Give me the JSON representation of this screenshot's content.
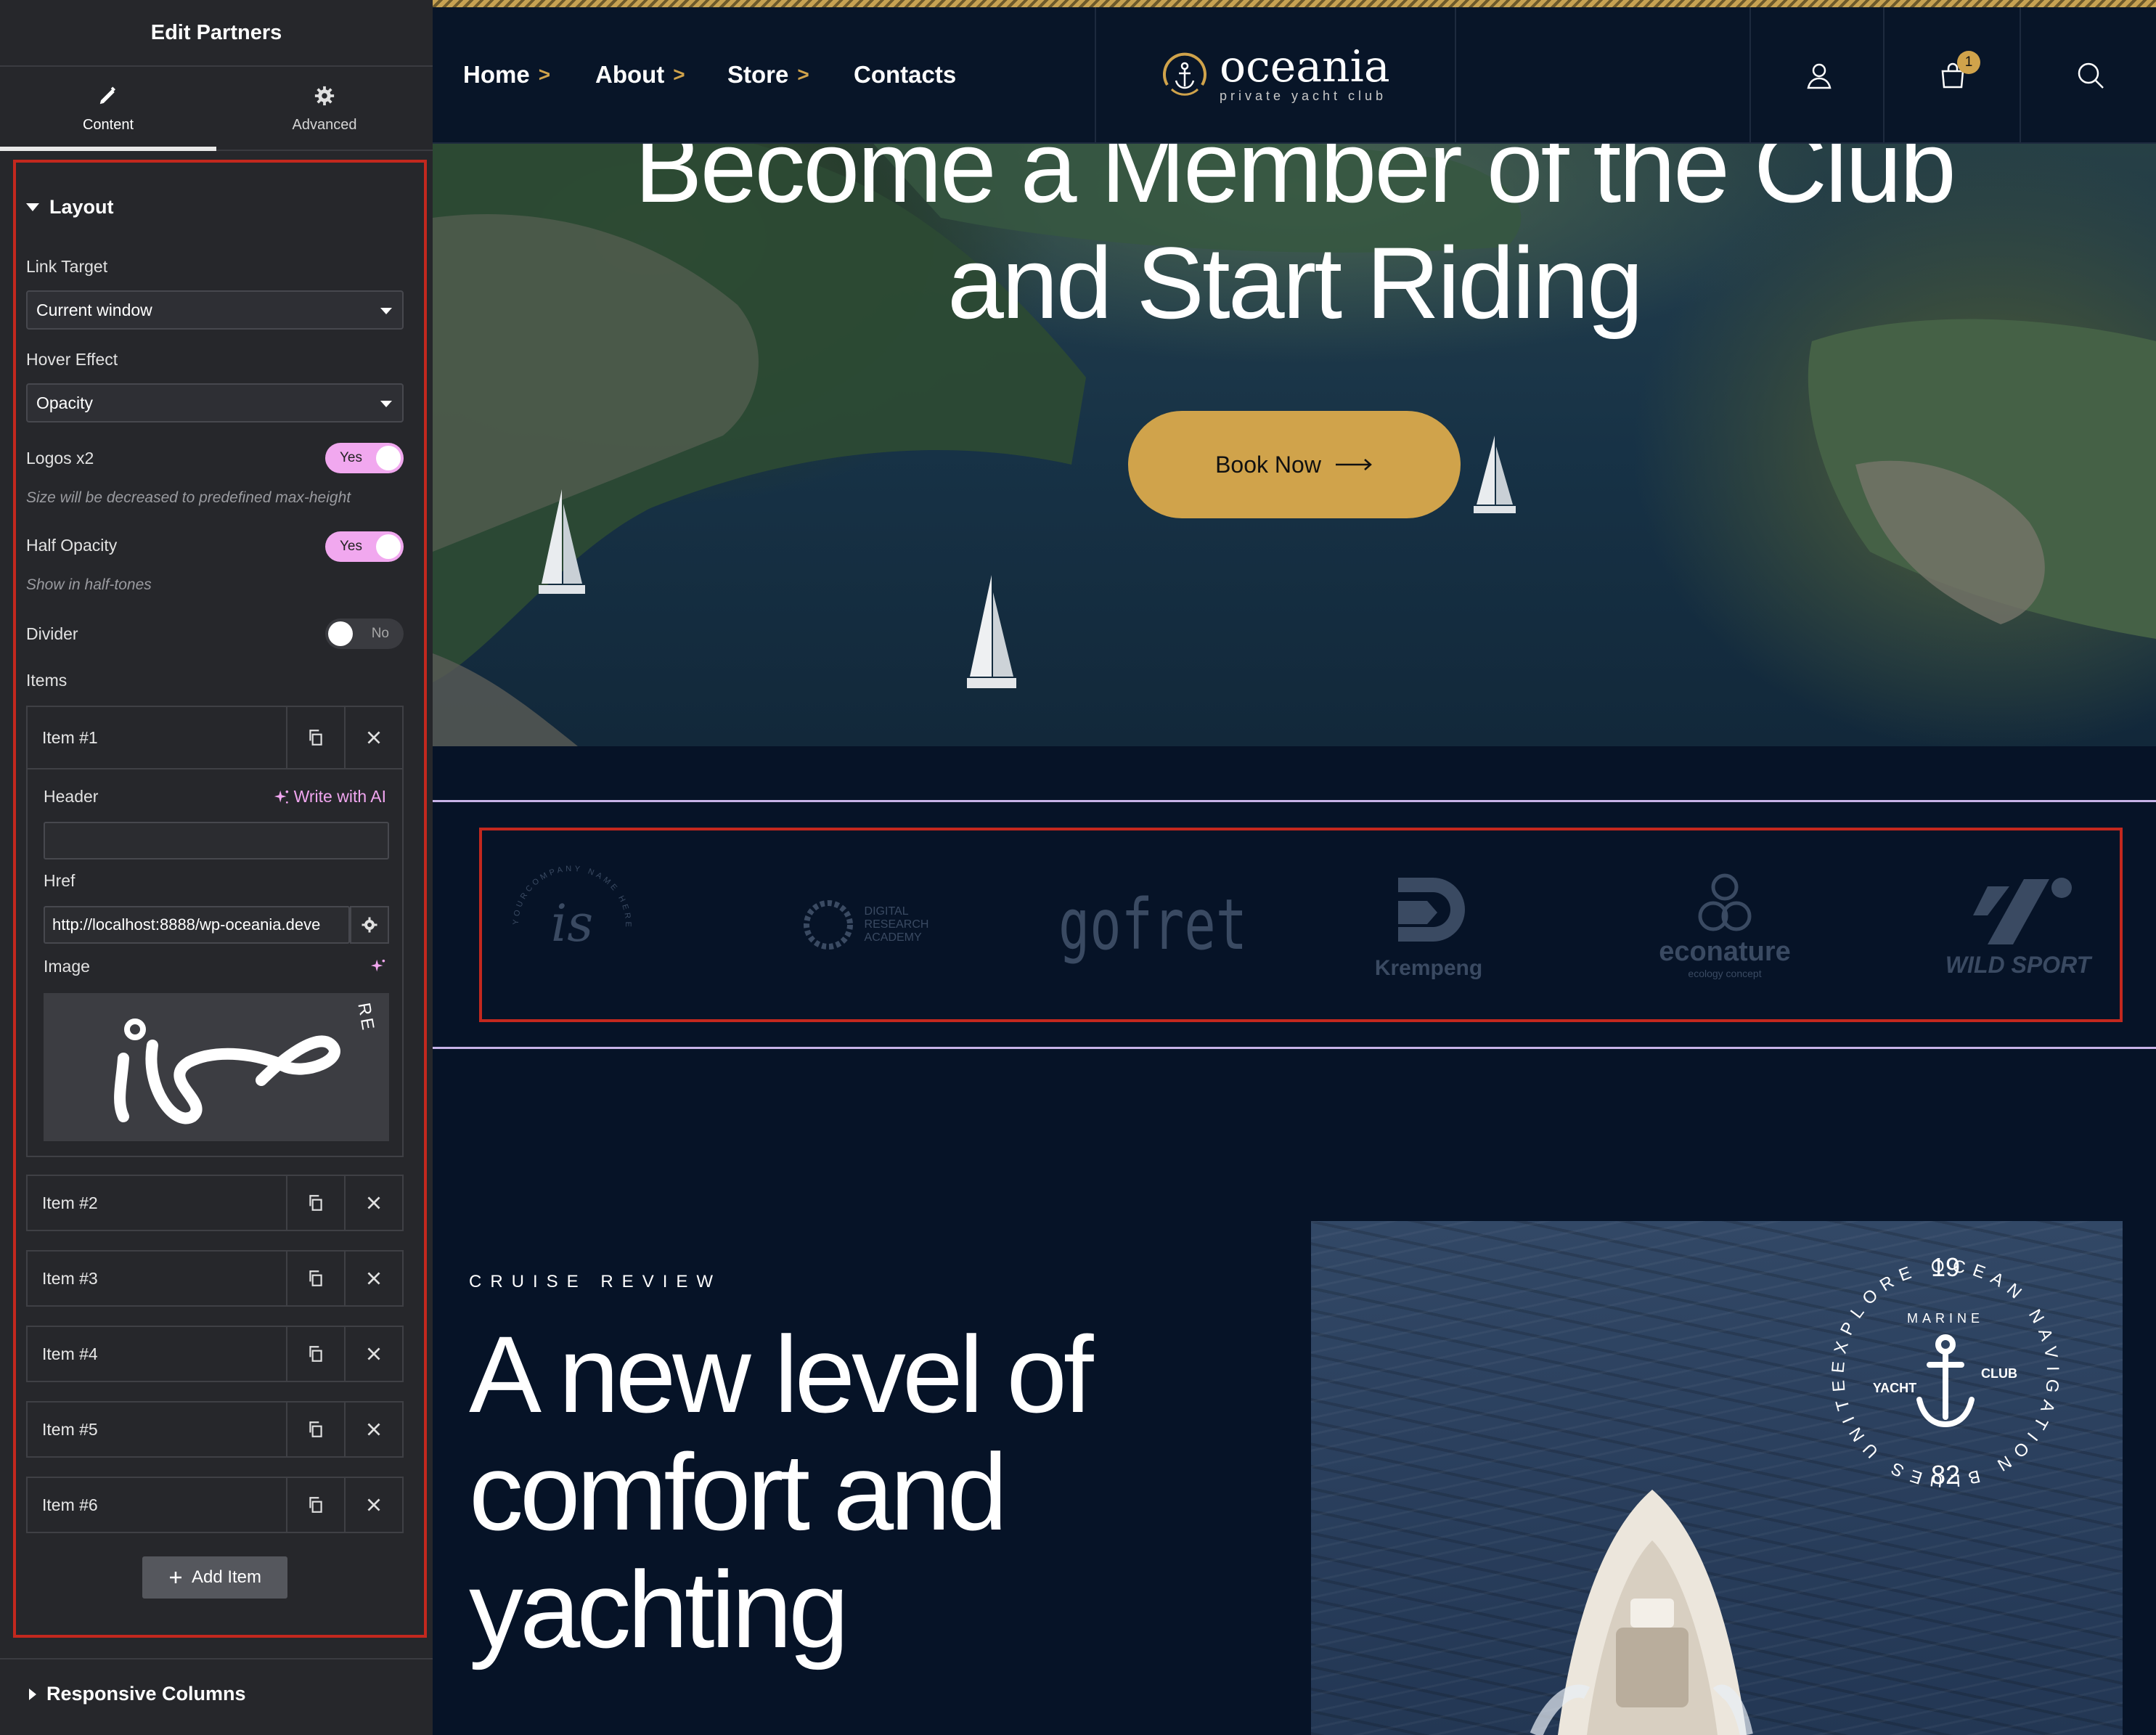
{
  "editor": {
    "title": "Edit Partners",
    "tabs": [
      {
        "label": "Content"
      },
      {
        "label": "Advanced"
      }
    ],
    "section_title": "Layout",
    "link_target": {
      "label": "Link Target",
      "value": "Current window"
    },
    "hover_effect": {
      "label": "Hover Effect",
      "value": "Opacity"
    },
    "logos_x2": {
      "label": "Logos x2",
      "state": "Yes",
      "hint": "Size will be decreased to predefined max-height"
    },
    "half_opacity": {
      "label": "Half Opacity",
      "state": "Yes",
      "hint": "Show in half-tones"
    },
    "divider": {
      "label": "Divider",
      "state": "No"
    },
    "items_label": "Items",
    "items": [
      {
        "label": "Item #1"
      },
      {
        "label": "Item #2"
      },
      {
        "label": "Item #3"
      },
      {
        "label": "Item #4"
      },
      {
        "label": "Item #5"
      },
      {
        "label": "Item #6"
      }
    ],
    "item1": {
      "header_label": "Header",
      "write_ai": "Write with AI",
      "header_value": "",
      "href_label": "Href",
      "href_value": "http://localhost:8888/wp-oceania.deve",
      "image_label": "Image",
      "preview_text": "RE"
    },
    "add_item": "Add Item",
    "responsive_title": "Responsive Columns"
  },
  "site": {
    "nav": [
      {
        "label": "Home",
        "chevron": ">"
      },
      {
        "label": "About",
        "chevron": ">"
      },
      {
        "label": "Store",
        "chevron": ">"
      },
      {
        "label": "Contacts",
        "chevron": ""
      }
    ],
    "brand": {
      "name": "oceania",
      "tagline": "private yacht club"
    },
    "cart_count": "1",
    "hero": {
      "line1": "Become a Member of the Club",
      "line2": "and Start Riding",
      "button": "Book Now"
    },
    "partners": {
      "logo1_ring": "YOURCOMPANY NAME HERE",
      "logo1_mark": "is",
      "logo2": [
        "DIGITAL",
        "RESEARCH",
        "ACADEMY"
      ],
      "logo3": "gofret",
      "logo4": "Krempeng",
      "logo5": "econature",
      "logo5_sub": "ecology concept",
      "logo6": "WILD SPORT"
    },
    "review": {
      "eyebrow": "CRUISE REVIEW",
      "title": "A new level of comfort and yachting"
    },
    "badge": {
      "ring": "EXPLORE OCEAN NAVIGATION BLUES UNITED",
      "top": "19",
      "bottom": "82",
      "marine": "MARINE",
      "yacht": "YACHT",
      "club": "CLUB"
    }
  },
  "colors": {
    "accent_gold": "#d0a34b",
    "toggle_on": "#f1a8ef",
    "frame_red": "#c3281e",
    "site_bg": "#061327",
    "panel_bg": "#26272b"
  }
}
